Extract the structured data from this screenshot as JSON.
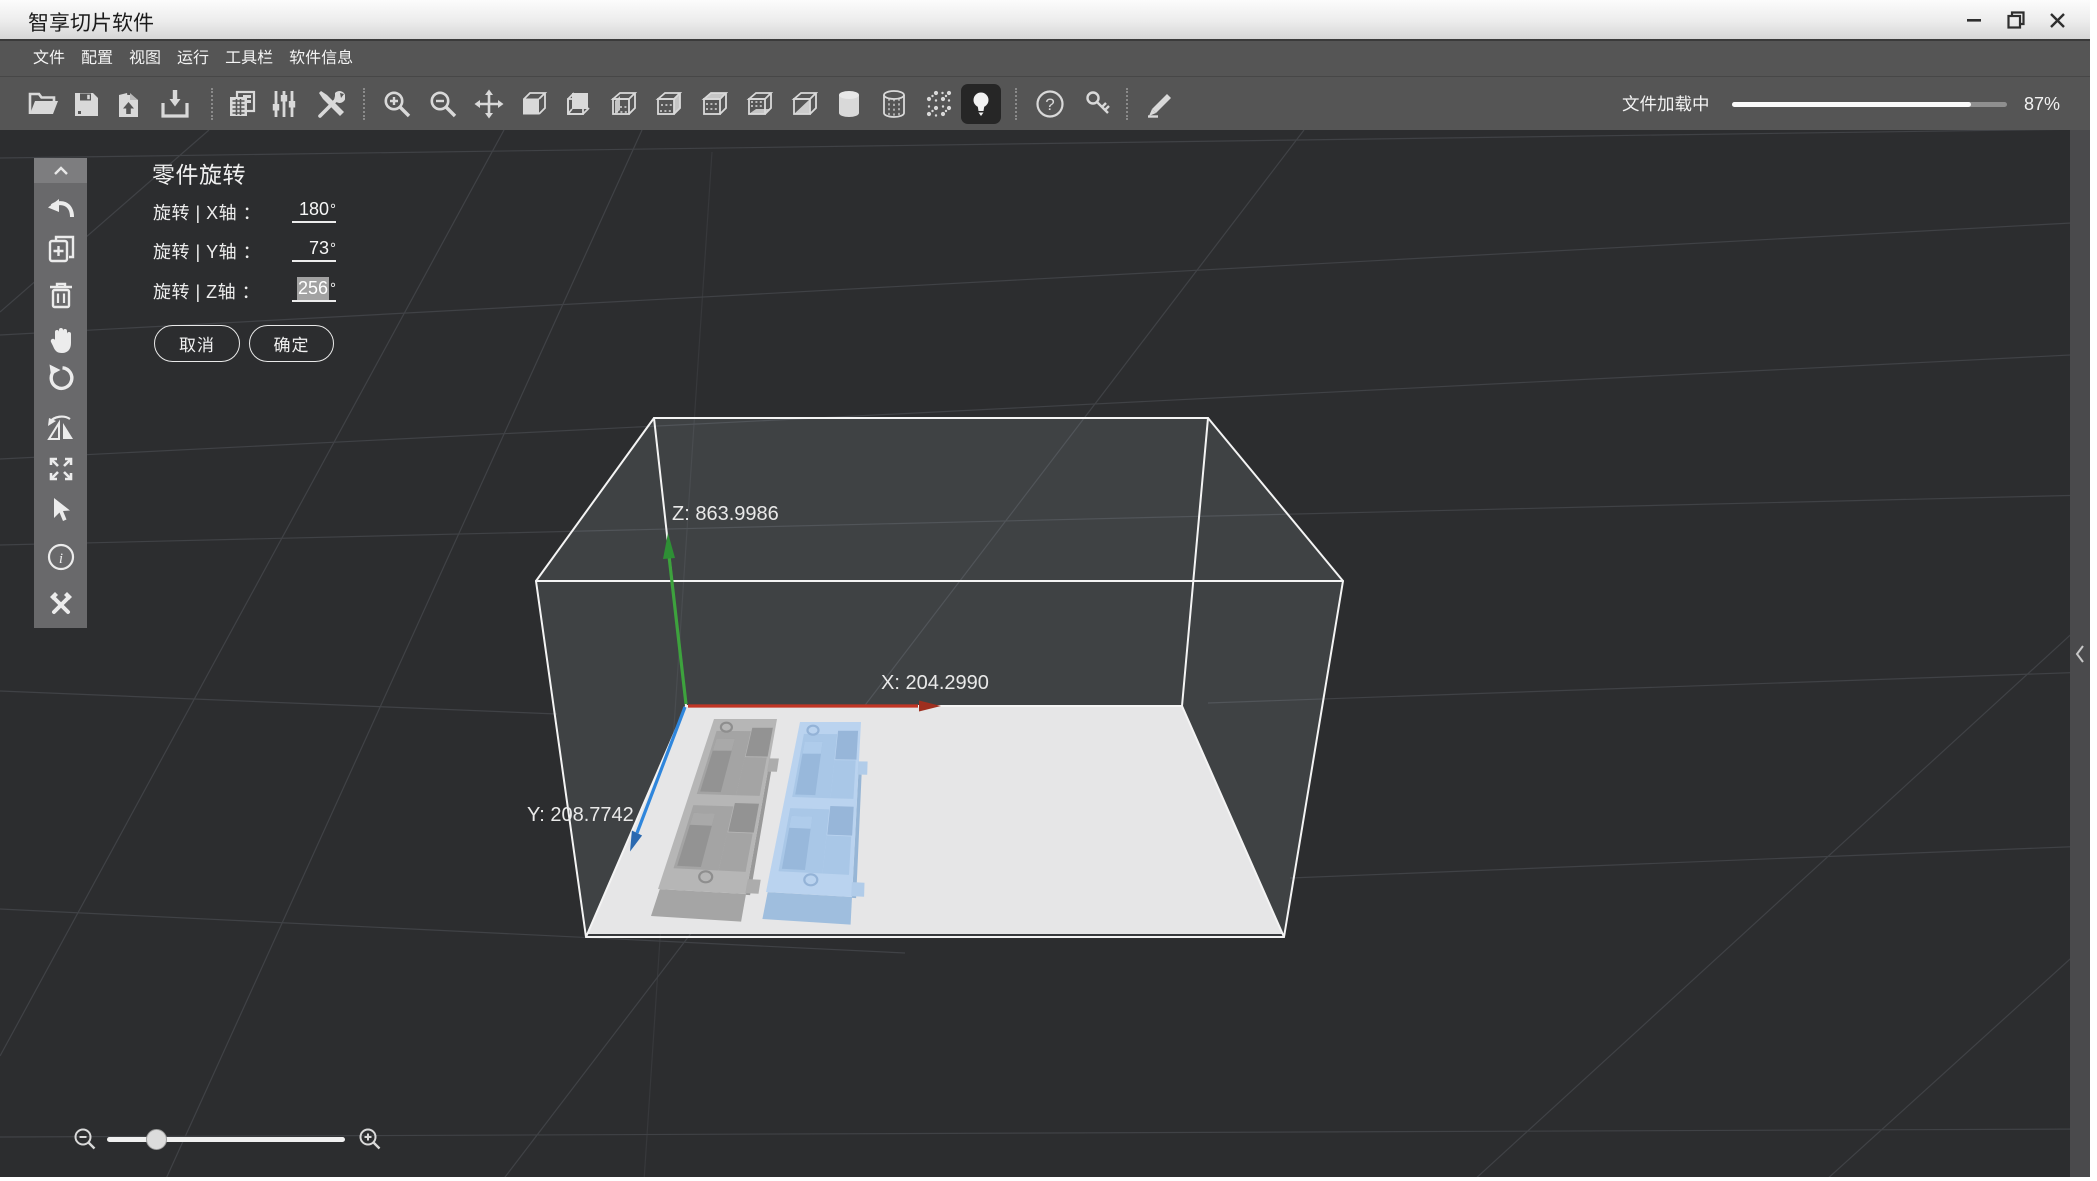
{
  "window": {
    "title": "智享切片软件"
  },
  "menu": {
    "items": [
      "文件",
      "配置",
      "视图",
      "运行",
      "工具栏",
      "软件信息"
    ]
  },
  "toolbar": {
    "progress": {
      "label": "文件加载中",
      "percent": 87,
      "percent_label": "87%"
    }
  },
  "rotation_panel": {
    "title": "零件旋转",
    "rows": [
      {
        "label": "旋转 | X轴 ：",
        "value": "180",
        "unit": "°",
        "selected": false
      },
      {
        "label": "旋转 | Y轴 ：",
        "value": "73",
        "unit": "°",
        "selected": false
      },
      {
        "label": "旋转 | Z轴 ：",
        "value": "256",
        "unit": "°",
        "selected": true
      }
    ],
    "cancel_label": "取消",
    "ok_label": "确定"
  },
  "scene": {
    "axis_labels": {
      "z": "Z:  863.9986",
      "x": "X: 204.2990",
      "y": "Y:  208.7742"
    },
    "colors": {
      "background": "#2c2d2f",
      "floor": "#e6e6e7",
      "axis_x": "#c13525",
      "axis_y": "#2f86dc",
      "axis_z": "#3da23d",
      "object_gray": "#b6b6b6",
      "object_blue": "#bad3ef",
      "wireframe": "#f4f4f4"
    }
  }
}
